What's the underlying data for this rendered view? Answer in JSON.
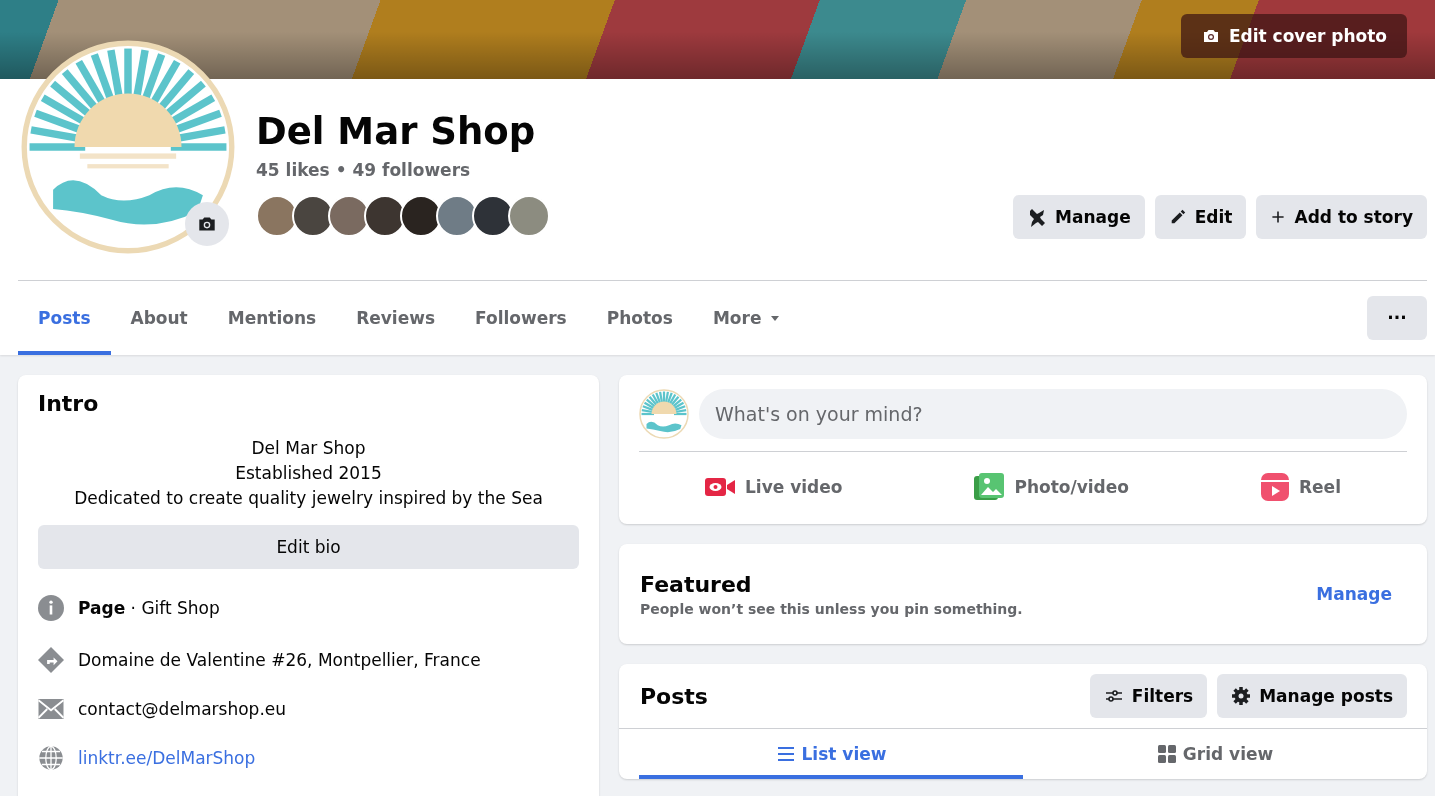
{
  "cover": {
    "edit_button": "Edit cover photo"
  },
  "page": {
    "name": "Del Mar Shop",
    "stats": "45 likes • 49 followers",
    "follower_avatars": [
      {
        "kind": "photo"
      },
      {
        "kind": "photo"
      },
      {
        "kind": "photo"
      },
      {
        "kind": "photo"
      },
      {
        "kind": "photo"
      },
      {
        "kind": "photo"
      },
      {
        "kind": "photo"
      },
      {
        "kind": "photo"
      }
    ]
  },
  "actions": [
    {
      "kind": "manage",
      "label": "Manage"
    },
    {
      "kind": "edit",
      "label": "Edit"
    },
    {
      "kind": "story",
      "label": "Add to story"
    }
  ],
  "tabs": [
    {
      "label": "Posts",
      "selected": true
    },
    {
      "label": "About",
      "selected": false
    },
    {
      "label": "Mentions",
      "selected": false
    },
    {
      "label": "Reviews",
      "selected": false
    },
    {
      "label": "Followers",
      "selected": false
    },
    {
      "label": "Photos",
      "selected": false
    },
    {
      "label": "More",
      "selected": false,
      "dropdown": true
    }
  ],
  "more_button": "···",
  "intro": {
    "title": "Intro",
    "bio": [
      "Del Mar Shop",
      "Established 2015",
      "Dedicated to create quality jewelry inspired by the Sea"
    ],
    "edit_bio": "Edit bio",
    "details": [
      {
        "kind": "info",
        "text": "**Page** · Gift Shop"
      },
      {
        "kind": "address",
        "text": "Domaine de Valentine #26, Montpellier, France"
      },
      {
        "kind": "email",
        "text": "contact@delmarshop.eu"
      },
      {
        "kind": "link",
        "text": "linktr.ee/DelMarShop"
      }
    ]
  },
  "composer": {
    "placeholder": "What's on your mind?",
    "actions": [
      {
        "kind": "live",
        "label": "Live video"
      },
      {
        "kind": "photo",
        "label": "Photo/video"
      },
      {
        "kind": "reel",
        "label": "Reel"
      }
    ]
  },
  "featured": {
    "title": "Featured",
    "note": "People won’t see this unless you pin something.",
    "manage": "Manage"
  },
  "posts": {
    "title": "Posts",
    "buttons": [
      {
        "kind": "filters",
        "label": "Filters"
      },
      {
        "kind": "manage",
        "label": "Manage posts"
      }
    ],
    "views": [
      {
        "kind": "list",
        "label": "List view",
        "selected": true
      },
      {
        "kind": "grid",
        "label": "Grid view",
        "selected": false
      }
    ]
  }
}
